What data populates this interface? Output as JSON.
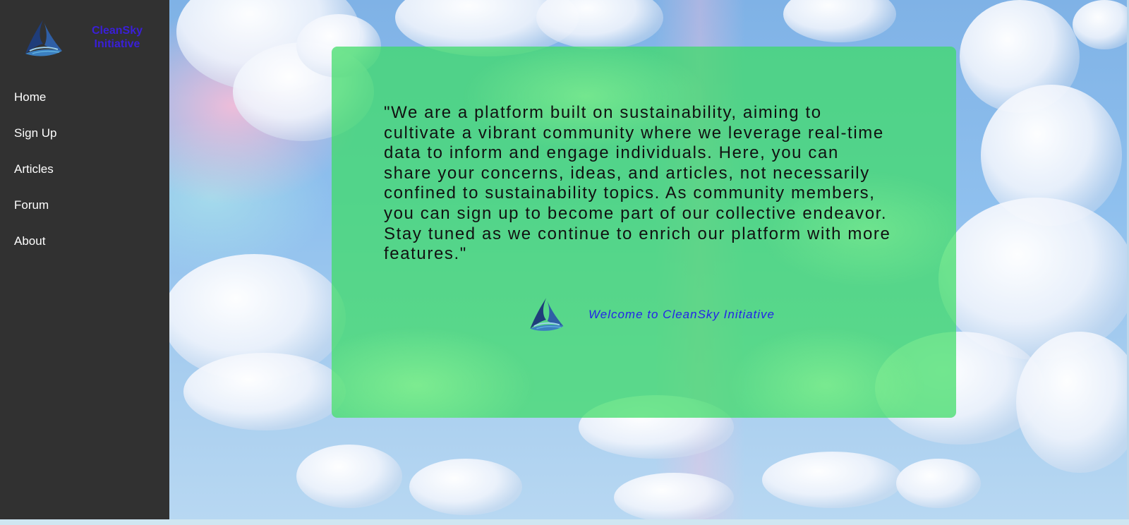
{
  "brand": {
    "name_line1": "CleanSky",
    "name_line2": "Initiative",
    "logo_icon": "triangle-swirl-logo-icon"
  },
  "sidebar": {
    "items": [
      {
        "label": "Home"
      },
      {
        "label": "Sign Up"
      },
      {
        "label": "Articles"
      },
      {
        "label": "Forum"
      },
      {
        "label": "About"
      }
    ]
  },
  "main": {
    "mission_text": "\"We are a platform built on sustainability, aiming to cultivate a vibrant community where we leverage real-time data to inform and engage individuals. Here, you can share your concerns, ideas, and articles, not necessarily confined to sustainability topics. As community members, you can sign up to become part of our collective endeavor. Stay tuned as we continue to enrich our platform with more features.\"",
    "welcome_text": "Welcome to CleanSky Initiative"
  },
  "colors": {
    "sidebar_bg": "#313131",
    "brand_text": "#3a1fd8",
    "panel_green": "#3cdc64",
    "welcome_text": "#2323e8"
  }
}
